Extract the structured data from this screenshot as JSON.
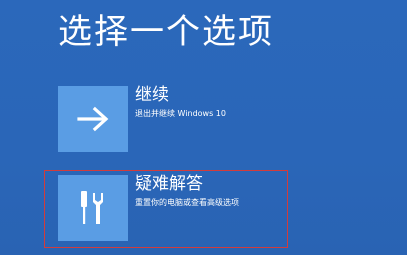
{
  "page": {
    "title": "选择一个选项"
  },
  "options": [
    {
      "title": "继续",
      "description": "退出并继续 Windows 10",
      "icon": "arrow-right-icon"
    },
    {
      "title": "疑难解答",
      "description": "重置你的电脑或查看高级选项",
      "icon": "tools-icon"
    }
  ],
  "colors": {
    "background": "#2a66b8",
    "tile": "#5a9de4",
    "text": "#ffffff",
    "highlight": "#d23c3c"
  }
}
